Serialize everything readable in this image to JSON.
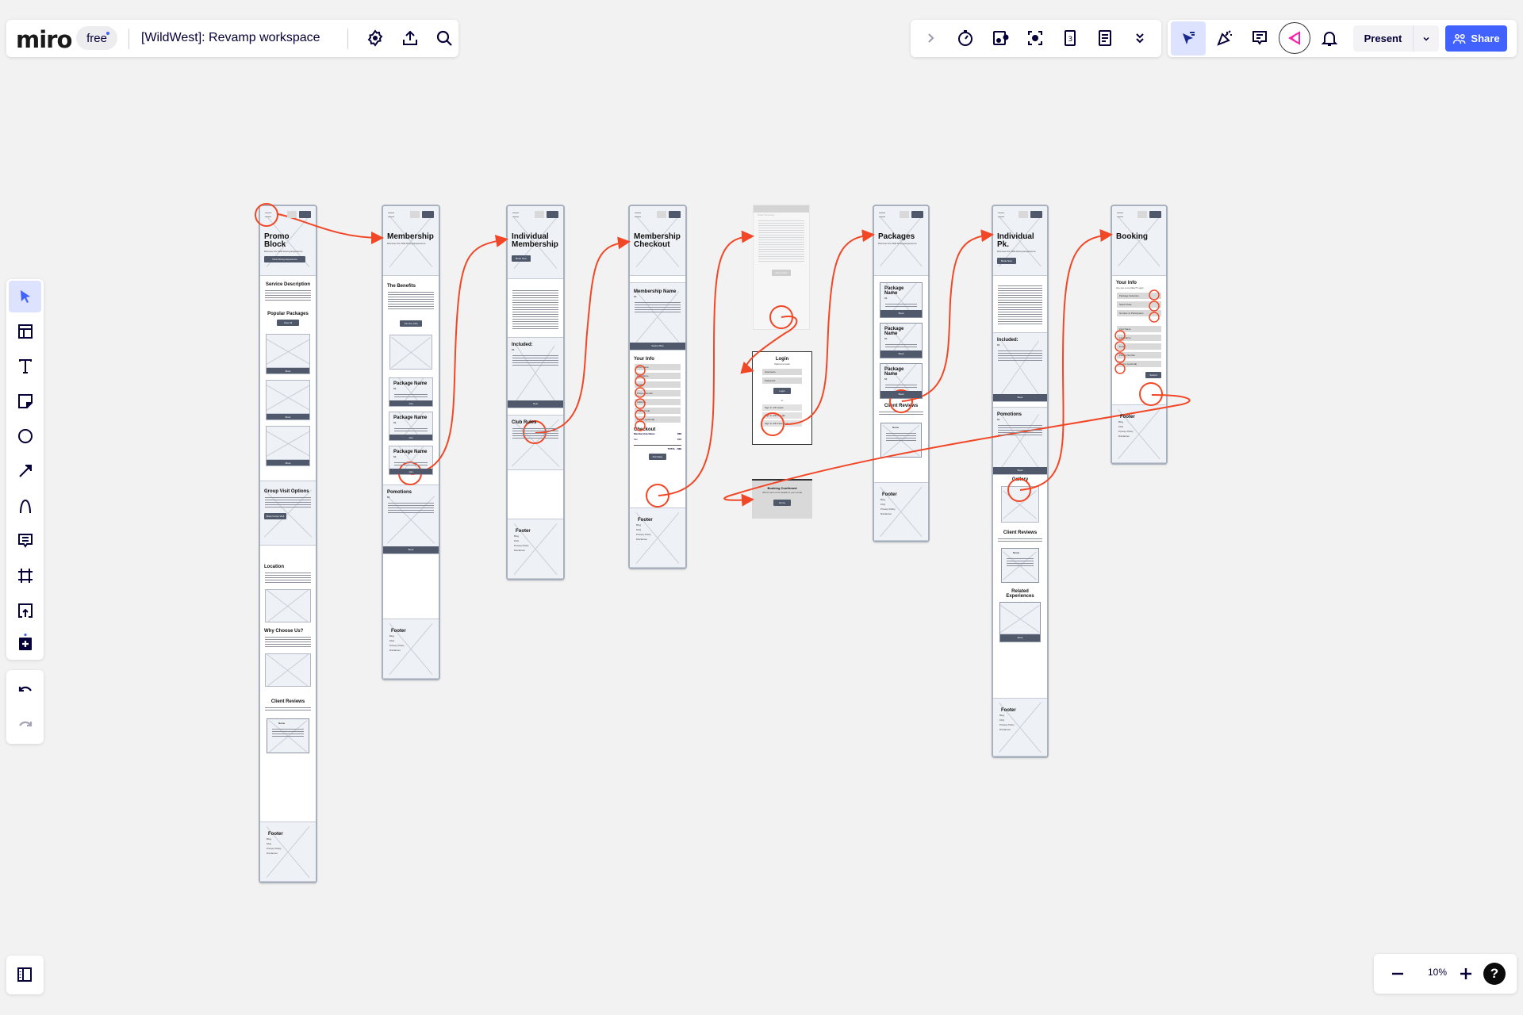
{
  "app": {
    "logo": "miro",
    "plan_badge": "free",
    "board_title": "[WildWest]: Revamp workspace"
  },
  "topbar_left": {
    "icons": [
      "settings-icon",
      "export-icon",
      "search-icon"
    ]
  },
  "toolbar_tools": {
    "icons": [
      "expand-chevron-icon",
      "timer-icon",
      "voting-icon",
      "focus-icon",
      "cards-icon",
      "notes-icon",
      "more-icon"
    ]
  },
  "toolbar_collab": {
    "icons": [
      "reactions-cursor-icon",
      "celebrate-icon",
      "comments-icon",
      "user-avatar",
      "notifications-icon"
    ],
    "present_label": "Present",
    "share_label": "Share"
  },
  "left_tools": [
    "select",
    "templates",
    "text",
    "sticky-note",
    "shape",
    "connection-line",
    "pen",
    "comment",
    "frame",
    "upload",
    "more-apps"
  ],
  "history": [
    "undo",
    "redo"
  ],
  "zoom": {
    "level": "10%",
    "help": "?"
  },
  "colors": {
    "accent": "#4262ff",
    "connector": "#f24726",
    "wire_button": "#4f596b"
  },
  "frames": {
    "promo": {
      "title": "Promo Block",
      "subtitle": "Discover the Wild Dining Experience",
      "cta": "View Dining Experience",
      "service_title": "Service Description",
      "packages_title": "Popular Packages",
      "packages_cta": "View All",
      "card_cta": "More",
      "group_title": "Group Visit Options",
      "group_cta": "Book Group Visit",
      "location_title": "Location",
      "why_title": "Why Choose Us?",
      "reviews_title": "Client Reviews",
      "review_name": "Name",
      "footer_title": "Footer",
      "footer_links": [
        "Blog",
        "FAQ",
        "Privacy Policy",
        "Disclaimer"
      ]
    },
    "membership": {
      "title": "Membership",
      "subtitle": "Discover the Wild Dining Experience",
      "benefits_title": "The Benefits",
      "benefits_cta": "Join the Club",
      "package_title": "Package Name",
      "price": "$$",
      "card_cta": "Join",
      "promo_title": "Pomotions",
      "promo_cta": "Book",
      "footer_title": "Footer",
      "footer_links": [
        "Blog",
        "FAQ",
        "Privacy Policy",
        "Disclaimer"
      ]
    },
    "individual_membership": {
      "title": "Individual Membership",
      "cta": "Book Now",
      "included_title": "Included:",
      "price": "$$",
      "bar_cta": "Next",
      "rules_title": "Club Rules",
      "footer_title": "Footer",
      "footer_links": [
        "Blog",
        "FAQ",
        "Privacy Policy",
        "Disclaimer"
      ]
    },
    "membership_checkout": {
      "title": "Membership Checkout",
      "name_title": "Membership Name",
      "price": "$$",
      "bar_cta": "Select Plan",
      "info_title": "Your Info",
      "fields": [
        "First Name",
        "Last Name",
        "Email",
        "Phone Number",
        "Address",
        "Postal Code",
        "Promo (optional)"
      ],
      "checkout_title": "Checkout",
      "line_items": [
        {
          "label": "Membership Name",
          "value": "$$$"
        },
        {
          "label": "Tax",
          "value": "$$$"
        }
      ],
      "total": "TOTAL : $$$",
      "cta": "Purchase",
      "footer_title": "Footer",
      "footer_links": [
        "Blog",
        "FAQ",
        "Privacy Policy",
        "Disclaimer"
      ]
    },
    "order_summary": {
      "title": "Order Summary",
      "cta": "Place Order"
    },
    "login": {
      "title": "Login",
      "subtitle": "Welcome back",
      "fields": [
        "Username",
        "Password"
      ],
      "cta": "Login",
      "or": "or",
      "social": [
        "Sign in with Apple",
        "Sign in with Google",
        "Sign in with Facebook"
      ]
    },
    "booking_confirmed": {
      "title": "Booking Confirmed",
      "subtitle": "We've sent more details to your email",
      "cta": "Home"
    },
    "packages": {
      "title": "Packages",
      "subtitle": "Discover the Wild Dining Experience",
      "package_title": "Package Name",
      "price": "$$",
      "card_cta": "Book",
      "reviews_title": "Client Reviews",
      "review_name": "Name",
      "footer_title": "Footer",
      "footer_links": [
        "Blog",
        "FAQ",
        "Privacy Policy",
        "Disclaimer"
      ]
    },
    "individual_pk": {
      "title": "Individual Pk.",
      "subtitle": "Discover the Wild Dining Experience",
      "cta": "Book Now",
      "included_title": "Included:",
      "promo_title": "Pomotions",
      "price": "$$",
      "bar_cta": "Book",
      "gallery_title": "Gallery",
      "reviews_title": "Client Reviews",
      "review_name": "Name",
      "related_title": "Related Experiences",
      "related_cta": "More",
      "footer_title": "Footer",
      "footer_links": [
        "Blog",
        "FAQ",
        "Privacy Policy",
        "Disclaimer"
      ]
    },
    "booking": {
      "title": "Booking",
      "info_title": "Your Info",
      "info_sub": "Are you a member? Login",
      "selects": [
        "Package Selection",
        "Select Date",
        "Number of Participants"
      ],
      "fields": [
        "First Name",
        "Last Name",
        "Email",
        "Phone Number",
        "Promo (optional)"
      ],
      "cta": "Submit",
      "footer_title": "Footer",
      "footer_links": [
        "Blog",
        "FAQ",
        "Privacy Policy",
        "Disclaimer"
      ]
    }
  }
}
